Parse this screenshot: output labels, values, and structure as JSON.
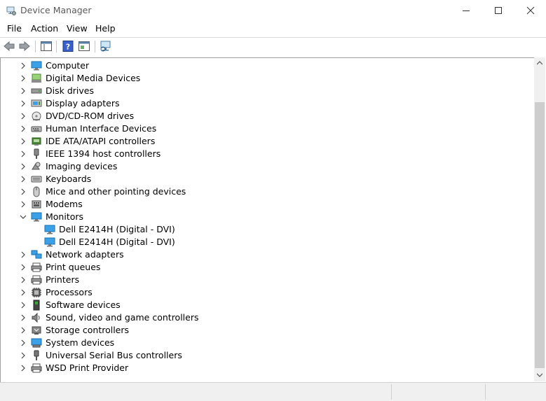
{
  "window": {
    "title": "Device Manager"
  },
  "menu": [
    "File",
    "Action",
    "View",
    "Help"
  ],
  "tree": [
    {
      "label": "Computer",
      "icon": "computer-icon",
      "expanded": false
    },
    {
      "label": "Digital Media Devices",
      "icon": "media-device-icon",
      "expanded": false
    },
    {
      "label": "Disk drives",
      "icon": "disk-drive-icon",
      "expanded": false
    },
    {
      "label": "Display adapters",
      "icon": "display-adapter-icon",
      "expanded": false
    },
    {
      "label": "DVD/CD-ROM drives",
      "icon": "dvd-drive-icon",
      "expanded": false
    },
    {
      "label": "Human Interface Devices",
      "icon": "hid-icon",
      "expanded": false
    },
    {
      "label": "IDE ATA/ATAPI controllers",
      "icon": "ide-controller-icon",
      "expanded": false
    },
    {
      "label": "IEEE 1394 host controllers",
      "icon": "ieee1394-icon",
      "expanded": false
    },
    {
      "label": "Imaging devices",
      "icon": "imaging-device-icon",
      "expanded": false
    },
    {
      "label": "Keyboards",
      "icon": "keyboard-icon",
      "expanded": false
    },
    {
      "label": "Mice and other pointing devices",
      "icon": "mouse-icon",
      "expanded": false
    },
    {
      "label": "Modems",
      "icon": "modem-icon",
      "expanded": false
    },
    {
      "label": "Monitors",
      "icon": "monitor-icon",
      "expanded": true,
      "children": [
        "Dell E2414H (Digital - DVI)",
        "Dell E2414H (Digital - DVI)"
      ]
    },
    {
      "label": "Network adapters",
      "icon": "network-adapter-icon",
      "expanded": false
    },
    {
      "label": "Print queues",
      "icon": "print-queue-icon",
      "expanded": false
    },
    {
      "label": "Printers",
      "icon": "printer-icon",
      "expanded": false
    },
    {
      "label": "Processors",
      "icon": "processor-icon",
      "expanded": false
    },
    {
      "label": "Software devices",
      "icon": "software-device-icon",
      "expanded": false
    },
    {
      "label": "Sound, video and game controllers",
      "icon": "sound-icon",
      "expanded": false
    },
    {
      "label": "Storage controllers",
      "icon": "storage-controller-icon",
      "expanded": false
    },
    {
      "label": "System devices",
      "icon": "system-device-icon",
      "expanded": false
    },
    {
      "label": "Universal Serial Bus controllers",
      "icon": "usb-icon",
      "expanded": false
    },
    {
      "label": "WSD Print Provider",
      "icon": "wsd-printer-icon",
      "expanded": false
    }
  ],
  "colors": {
    "accent": "#1e90ff",
    "chevron": "#444444"
  }
}
